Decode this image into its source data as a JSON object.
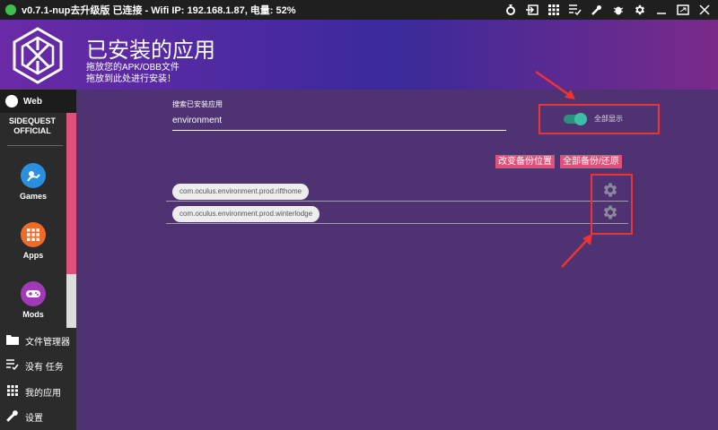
{
  "titlebar": {
    "title": "v0.7.1-nup去升级版  已连接 - Wifi IP: 192.168.1.87, 电量: 52%",
    "icons": [
      "ring-icon",
      "enter-icon",
      "grid-icon",
      "tasks-icon",
      "wrench-icon",
      "bug-icon",
      "gear-icon",
      "minimize-icon",
      "maximize-icon",
      "close-icon"
    ]
  },
  "header": {
    "title": "已安装的应用",
    "subtitle1": "拖放您的APK/OBB文件",
    "subtitle2": "拖放到此处进行安装！"
  },
  "sidebar": {
    "web": "Web",
    "sidequest_line1": "SIDEQUEST",
    "sidequest_line2": "OFFICIAL",
    "games": "Games",
    "apps": "Apps",
    "mods": "Mods",
    "file_manager": "文件管理器",
    "no_tasks": "没有 任务",
    "my_apps": "我的应用",
    "settings": "设置"
  },
  "main": {
    "search_label": "搜索已安装应用",
    "search_value": "environment",
    "toggle_label": "全部显示",
    "toggle_on": true,
    "change_backup_button": "改变备份位置",
    "backup_restore_button": "全部备份/还原",
    "apps": [
      "com.oculus.environment.prod.rifthome",
      "com.oculus.environment.prod.winterlodge"
    ]
  },
  "colors": {
    "accent_pink": "#e0507a",
    "toggle_teal": "#3bc0a8",
    "highlight_red": "#e33333"
  }
}
